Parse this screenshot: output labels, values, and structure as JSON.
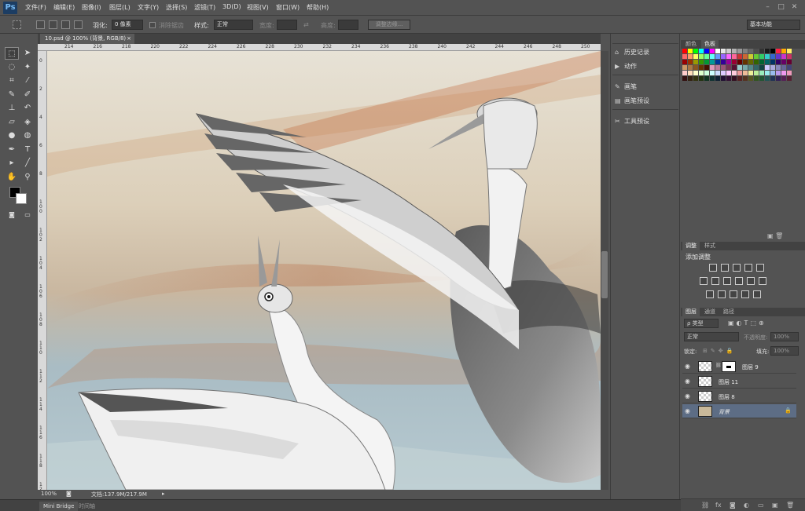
{
  "app": {
    "logo": "Ps"
  },
  "menu": [
    "文件(F)",
    "编辑(E)",
    "图像(I)",
    "图层(L)",
    "文字(Y)",
    "选择(S)",
    "滤镜(T)",
    "3D(D)",
    "视图(V)",
    "窗口(W)",
    "帮助(H)"
  ],
  "window_controls": [
    "–",
    "□",
    "✕"
  ],
  "options": {
    "feather_label": "羽化:",
    "feather_value": "0 像素",
    "antialias_label": "消除锯齿",
    "style_label": "样式:",
    "style_value": "正常",
    "width_label": "宽度:",
    "height_label": "高度:",
    "refine_edge": "调整边缘...",
    "workspace": "基本功能"
  },
  "document": {
    "tab_title": "10.psd @ 100% (背景, RGB/8)",
    "tab_close": "×"
  },
  "ruler_h": [
    "214",
    "216",
    "218",
    "220",
    "222",
    "224",
    "226",
    "228",
    "230",
    "232",
    "234",
    "236",
    "238",
    "240",
    "242",
    "244",
    "246",
    "248",
    "250"
  ],
  "ruler_v": [
    "0",
    "2",
    "4",
    "6",
    "8",
    "1 0 0",
    "1 0 2",
    "1 0 4",
    "1 0 6",
    "1 0 8",
    "1 1 0",
    "1 1 2",
    "1 1 4",
    "1 1 6",
    "1 1 8",
    "1 2 0"
  ],
  "status": {
    "zoom": "100%",
    "doc_info": "文档:137.9M/217.9M"
  },
  "bottom_tabs": {
    "mini_bridge": "Mini Bridge",
    "timeline": "时间轴"
  },
  "mid_panel": [
    {
      "icon": "history-icon",
      "label": "历史记录"
    },
    {
      "icon": "actions-icon",
      "label": "动作"
    },
    {
      "icon": "brush-icon",
      "label": "画笔"
    },
    {
      "icon": "brush-presets-icon",
      "label": "画笔预设"
    },
    {
      "icon": "tool-presets-icon",
      "label": "工具预设"
    }
  ],
  "color_panel": {
    "tabs": [
      "颜色",
      "色板"
    ],
    "active_tab": "色板"
  },
  "adjust_panel": {
    "tabs": [
      "调整",
      "样式"
    ],
    "title": "添加调整"
  },
  "layers_panel": {
    "tabs": [
      "图层",
      "通道",
      "路径"
    ],
    "filter_label": "ρ 类型",
    "blend_mode": "正常",
    "opacity_label": "不透明度:",
    "opacity_value": "100%",
    "lock_label": "锁定:",
    "fill_label": "填充:",
    "fill_value": "100%",
    "layers": [
      {
        "name": "图层 9",
        "selected": false,
        "has_mask": true
      },
      {
        "name": "图层 11",
        "selected": false,
        "has_mask": false
      },
      {
        "name": "图层 8",
        "selected": false,
        "has_mask": false
      },
      {
        "name": "背景",
        "selected": true,
        "has_mask": false,
        "locked": true
      }
    ]
  },
  "colors": {
    "accent": "#5d6d85",
    "panel_bg": "#535353",
    "dark": "#424242"
  }
}
